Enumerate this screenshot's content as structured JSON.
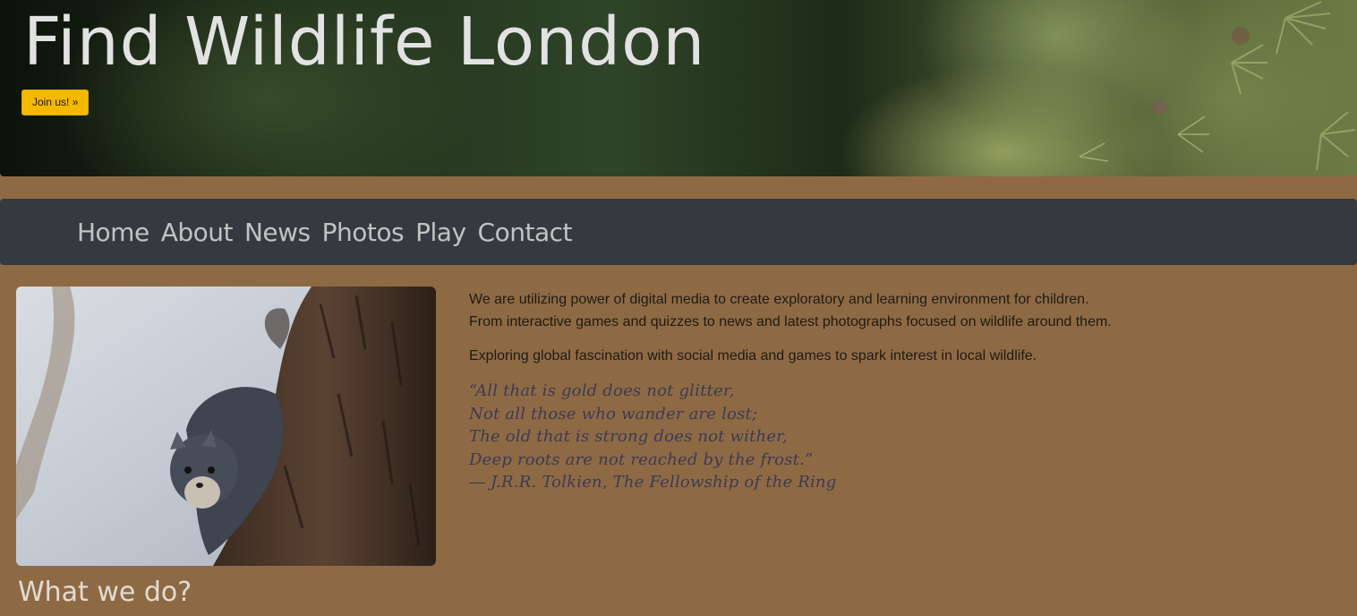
{
  "hero": {
    "title": "Find Wildlife London",
    "join_label": "Join us! »"
  },
  "nav": {
    "items": [
      {
        "label": "Home"
      },
      {
        "label": "About"
      },
      {
        "label": "News"
      },
      {
        "label": "Photos"
      },
      {
        "label": "Play"
      },
      {
        "label": "Contact"
      }
    ]
  },
  "main": {
    "photo_icon": "squirrel-on-tree-photo",
    "heading": "What we do?",
    "intro_line1": "We are utilizing power of digital media to create exploratory and learning environment for children.",
    "intro_line2": "From interactive games and quizzes to news and latest photographs focused on wildlife around them.",
    "intro_para2": "Exploring global fascination with social media and games to spark interest in local wildlife.",
    "quote": {
      "line1": "“All that is gold does not glitter,",
      "line2": "Not all those who wander are lost;",
      "line3": "The old that is strong does not wither,",
      "line4": "Deep roots are not reached by the frost.”",
      "attribution": "― J.R.R. Tolkien, The Fellowship of the Ring"
    }
  },
  "colors": {
    "page_background": "#8e6a44",
    "navbar_background": "#343a40",
    "nav_link": "#c2c2c2",
    "button_accent": "#f5b800",
    "quote_text": "#3c3a55"
  }
}
